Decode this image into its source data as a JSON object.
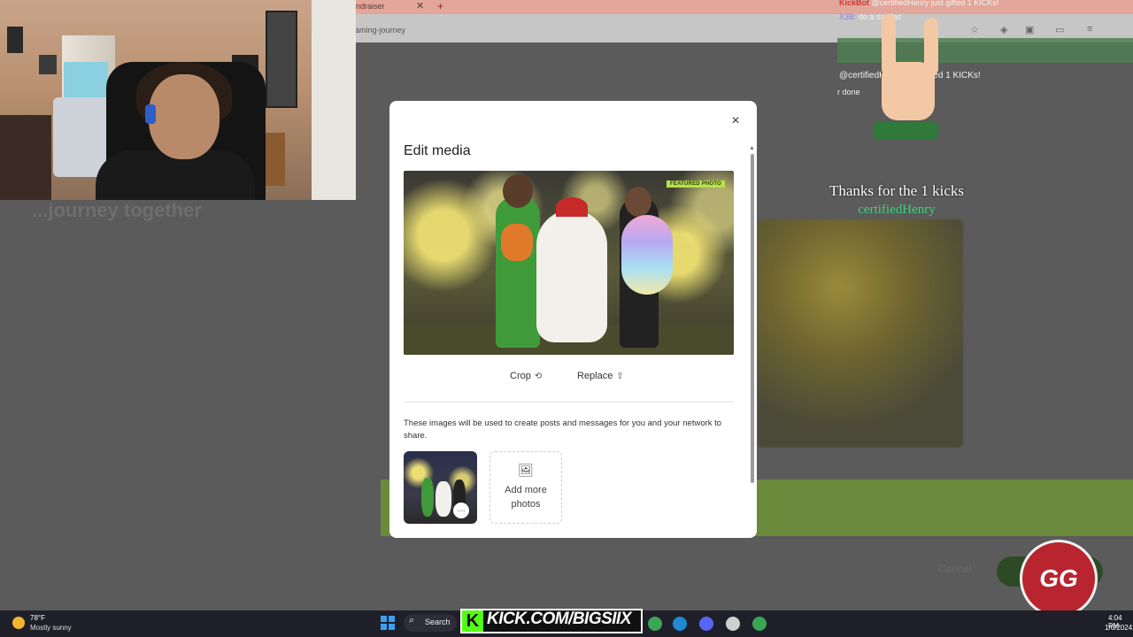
{
  "browser": {
    "tab_title": "ndraiser",
    "tab_close": "✕",
    "new_tab": "+",
    "url": "aming-journey"
  },
  "background_page": {
    "hero_text": "...journey together",
    "cancel_label": "Cancel"
  },
  "modal": {
    "title": "Edit media",
    "close_icon": "×",
    "featured_badge": "FEATURED PHOTO",
    "crop_label": "Crop",
    "crop_icon": "⟲",
    "replace_label": "Replace",
    "replace_icon": "⇪",
    "helper_text": "These images will be used to create posts and messages for you and your network to share.",
    "thumb_more_icon": "…",
    "add_more_icon": "🖼",
    "add_more_label": "Add more photos"
  },
  "stream_overlay": {
    "kickbot_name": "KickBot",
    "kickbot_msg": "@certifiedHenry just gifted 1 KICKs!",
    "chat_user": "X3B:",
    "chat_msg": "do a sadifac",
    "gift_message": "@certifiedHenry just gifted 1 KICKs!",
    "side_snippet": "r done",
    "thanks_text": "Thanks for the 1 kicks",
    "thanks_user": "certifiedHenry",
    "logo_text": "GG"
  },
  "taskbar": {
    "weather_temp": "78°F",
    "weather_desc": "Mostly sunny",
    "search_label": "Search",
    "search_icon": "⌕",
    "kick_k": "K",
    "kick_url": "KICK.COM/BIGSIIX",
    "clock_time": "4:04 PM",
    "clock_date": "1/6/2024"
  },
  "colors": {
    "kick_green": "#53fc18",
    "thanks_user": "#3ad07a",
    "featured_badge": "#b7e04a"
  }
}
